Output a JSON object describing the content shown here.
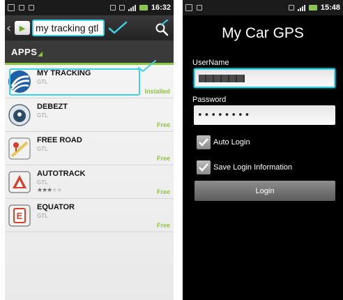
{
  "left_screen": {
    "status_bar": {
      "time": "16:32"
    },
    "search": {
      "query": "my tracking gtl"
    },
    "section_title": "APPS",
    "apps": [
      {
        "name": "MY TRACKING",
        "developer": "GTL",
        "status": "Installed"
      },
      {
        "name": "DEBEZT",
        "developer": "GTL",
        "status": "Free"
      },
      {
        "name": "FREE ROAD",
        "developer": "GTL",
        "status": "Free"
      },
      {
        "name": "AUTOTRACK",
        "developer": "GTL",
        "status": "Free",
        "rating": 3,
        "rating_max": 5
      },
      {
        "name": "EQUATOR",
        "developer": "GTL",
        "status": "Free"
      }
    ]
  },
  "right_screen": {
    "status_bar": {
      "time": "15:48"
    },
    "title": "My Car GPS",
    "username_label": "UserName",
    "password_label": "Password",
    "password_value": "••••••••",
    "auto_login_label": "Auto Login",
    "save_login_label": "Save Login Information",
    "login_button_label": "Login"
  },
  "colors": {
    "annotation_highlight": "#39d3e6",
    "market_green": "#8dc63f",
    "status_bar": "#1b1b1b"
  },
  "icons": [
    "market-logo-icon",
    "search-icon",
    "my-tracking-app-icon",
    "debezt-app-icon",
    "free-road-app-icon",
    "autotrack-app-icon",
    "equator-app-icon",
    "checkmark-icon"
  ]
}
